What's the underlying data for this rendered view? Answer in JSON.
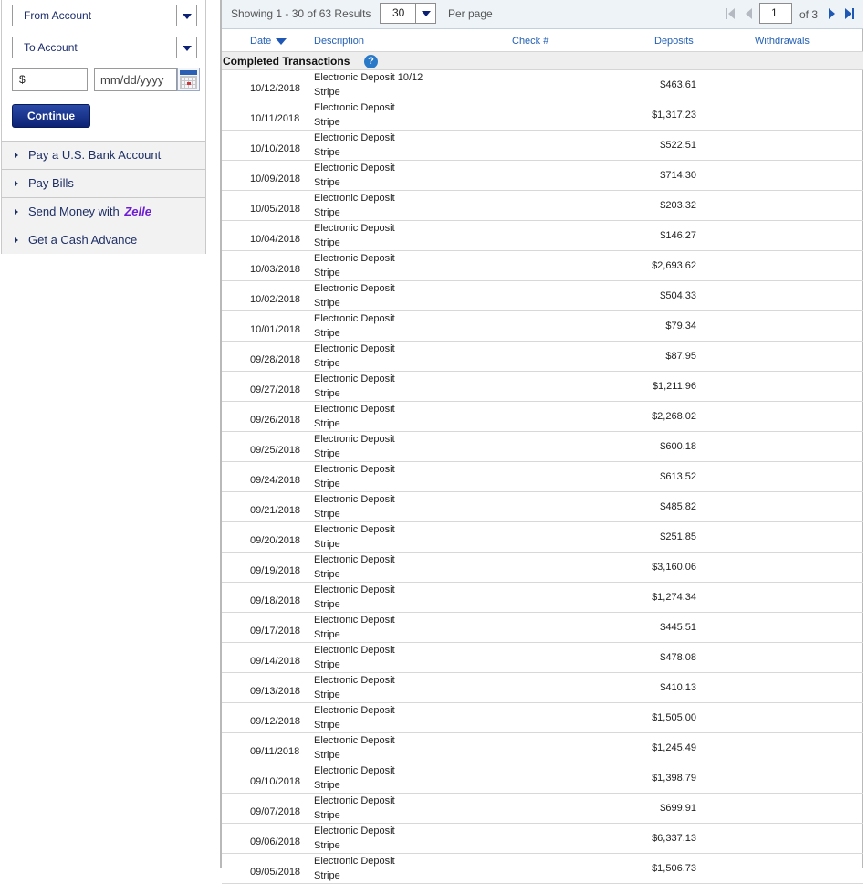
{
  "transfer": {
    "from_account": "From Account",
    "to_account": "To Account",
    "amount_value": "$",
    "date_placeholder": "mm/dd/yyyy",
    "continue_label": "Continue"
  },
  "nav": {
    "pay_bank": "Pay a U.S. Bank Account",
    "pay_bills": "Pay Bills",
    "send_money": "Send Money with",
    "zelle": "Zelle",
    "cash_advance": "Get a Cash Advance"
  },
  "pager": {
    "showing": "Showing 1 - 30 of 63 Results",
    "per_page_value": "30",
    "per_page_label": "Per page",
    "page_value": "1",
    "of_label": "of",
    "total_pages": "3"
  },
  "table": {
    "columns": {
      "date": "Date",
      "description": "Description",
      "check": "Check #",
      "deposits": "Deposits",
      "withdrawals": "Withdrawals"
    },
    "section_label": "Completed Transactions",
    "help_glyph": "?",
    "rows": [
      {
        "date": "10/12/2018",
        "desc1": "Electronic Deposit 10/12",
        "desc2": "Stripe",
        "amount": "$463.61"
      },
      {
        "date": "10/11/2018",
        "desc1": "Electronic Deposit",
        "desc2": "Stripe",
        "amount": "$1,317.23"
      },
      {
        "date": "10/10/2018",
        "desc1": "Electronic Deposit",
        "desc2": "Stripe",
        "amount": "$522.51"
      },
      {
        "date": "10/09/2018",
        "desc1": "Electronic Deposit",
        "desc2": "Stripe",
        "amount": "$714.30"
      },
      {
        "date": "10/05/2018",
        "desc1": "Electronic Deposit",
        "desc2": "Stripe",
        "amount": "$203.32"
      },
      {
        "date": "10/04/2018",
        "desc1": "Electronic Deposit",
        "desc2": "Stripe",
        "amount": "$146.27"
      },
      {
        "date": "10/03/2018",
        "desc1": "Electronic Deposit",
        "desc2": "Stripe",
        "amount": "$2,693.62"
      },
      {
        "date": "10/02/2018",
        "desc1": "Electronic Deposit",
        "desc2": "Stripe",
        "amount": "$504.33"
      },
      {
        "date": "10/01/2018",
        "desc1": "Electronic Deposit",
        "desc2": "Stripe",
        "amount": "$79.34"
      },
      {
        "date": "09/28/2018",
        "desc1": "Electronic Deposit",
        "desc2": "Stripe",
        "amount": "$87.95"
      },
      {
        "date": "09/27/2018",
        "desc1": "Electronic Deposit",
        "desc2": "Stripe",
        "amount": "$1,211.96"
      },
      {
        "date": "09/26/2018",
        "desc1": "Electronic Deposit",
        "desc2": "Stripe",
        "amount": "$2,268.02"
      },
      {
        "date": "09/25/2018",
        "desc1": "Electronic Deposit",
        "desc2": "Stripe",
        "amount": "$600.18"
      },
      {
        "date": "09/24/2018",
        "desc1": "Electronic Deposit",
        "desc2": "Stripe",
        "amount": "$613.52"
      },
      {
        "date": "09/21/2018",
        "desc1": "Electronic Deposit",
        "desc2": "Stripe",
        "amount": "$485.82"
      },
      {
        "date": "09/20/2018",
        "desc1": "Electronic Deposit",
        "desc2": "Stripe",
        "amount": "$251.85"
      },
      {
        "date": "09/19/2018",
        "desc1": "Electronic Deposit",
        "desc2": "Stripe",
        "amount": "$3,160.06"
      },
      {
        "date": "09/18/2018",
        "desc1": "Electronic Deposit",
        "desc2": "Stripe",
        "amount": "$1,274.34"
      },
      {
        "date": "09/17/2018",
        "desc1": "Electronic Deposit",
        "desc2": "Stripe",
        "amount": "$445.51"
      },
      {
        "date": "09/14/2018",
        "desc1": "Electronic Deposit",
        "desc2": "Stripe",
        "amount": "$478.08"
      },
      {
        "date": "09/13/2018",
        "desc1": "Electronic Deposit",
        "desc2": "Stripe",
        "amount": "$410.13"
      },
      {
        "date": "09/12/2018",
        "desc1": "Electronic Deposit",
        "desc2": "Stripe",
        "amount": "$1,505.00"
      },
      {
        "date": "09/11/2018",
        "desc1": "Electronic Deposit",
        "desc2": "Stripe",
        "amount": "$1,245.49"
      },
      {
        "date": "09/10/2018",
        "desc1": "Electronic Deposit",
        "desc2": "Stripe",
        "amount": "$1,398.79"
      },
      {
        "date": "09/07/2018",
        "desc1": "Electronic Deposit",
        "desc2": "Stripe",
        "amount": "$699.91"
      },
      {
        "date": "09/06/2018",
        "desc1": "Electronic Deposit",
        "desc2": "Stripe",
        "amount": "$6,337.13"
      },
      {
        "date": "09/05/2018",
        "desc1": "Electronic Deposit",
        "desc2": "Stripe",
        "amount": "$1,506.73"
      }
    ]
  }
}
